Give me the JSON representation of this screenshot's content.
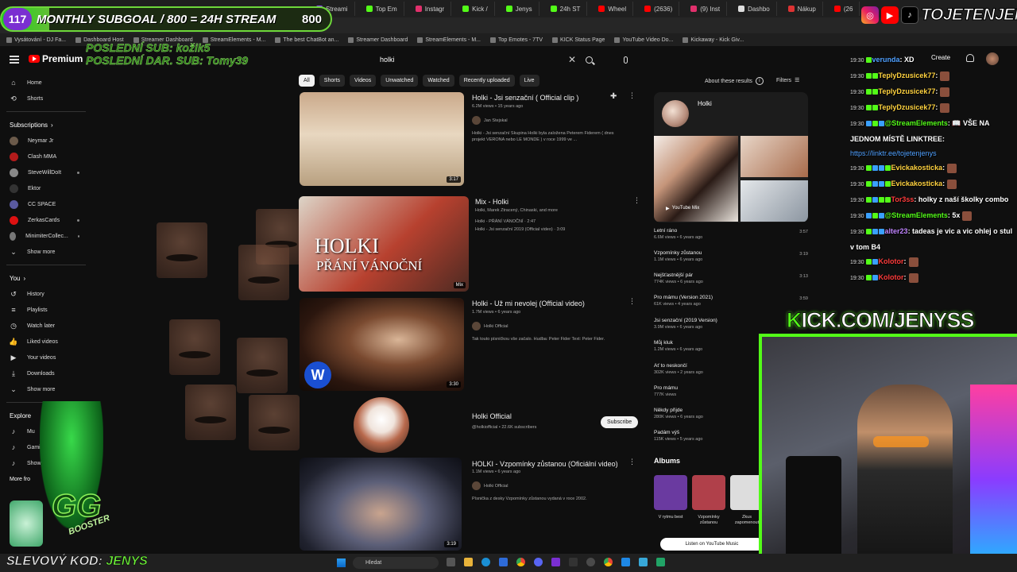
{
  "overlay": {
    "subgoal_count": "117",
    "subgoal_text": "MONTHLY SUBGOAL / 800 = 24H STREAM",
    "subgoal_target": "800",
    "subgoal_progress": 0.146,
    "last_sub_line1": "POSLEDNÍ SUB: kožik5",
    "last_sub_line2": "POSLEDNÍ DAR. SUB: Tomy39",
    "social_handle": "TOJETENJENYS",
    "kick_prefix": "K",
    "kick_rest": "ICK.COM/JENYSS",
    "coupon_label": "SLEVOVÝ KOD:",
    "coupon_code": "JENYS"
  },
  "browser": {
    "tabs": [
      "Streami",
      "Top Em",
      "Instagr",
      "Kick /",
      "Jenys",
      "24h ST",
      "Wheel",
      "(2636)",
      "(9) Inst",
      "Dashbo",
      "Nákup",
      "(26"
    ],
    "bookmarks": [
      "Vysátování - DJ Fa...",
      "Dashboard Host",
      "Streamer Dashboard",
      "StreamElements - M...",
      "The best ChatBot an...",
      "Streamer Dashboard",
      "StreamElements - M...",
      "Top Emotes - 7TV",
      "KICK Status Page",
      "YouTube Video Do...",
      "Kickaway - Kick Giv..."
    ]
  },
  "header": {
    "logo": "Premium",
    "search_value": "holki",
    "create_label": "Create"
  },
  "sidebar": {
    "main": [
      {
        "label": "Home",
        "icon": "home-icon"
      },
      {
        "label": "Shorts",
        "icon": "shorts-icon"
      }
    ],
    "subscriptions_title": "Subscriptions",
    "subscriptions": [
      {
        "label": "Neymar Jr",
        "color": "#6b5a4a"
      },
      {
        "label": "Clash MMA",
        "color": "#b31b1b"
      },
      {
        "label": "SteveWillDoIt",
        "color": "#888"
      },
      {
        "label": "Ektor",
        "color": "#333"
      },
      {
        "label": "CC SPACE",
        "color": "#5a5aa0"
      },
      {
        "label": "ZerkasCards",
        "color": "#d11"
      },
      {
        "label": "MinimiterCollec...",
        "color": "#777"
      }
    ],
    "show_more": "Show more",
    "you_title": "You",
    "you": [
      {
        "label": "History",
        "icon": "history-icon"
      },
      {
        "label": "Playlists",
        "icon": "playlists-icon"
      },
      {
        "label": "Watch later",
        "icon": "watch-later-icon"
      },
      {
        "label": "Liked videos",
        "icon": "liked-icon"
      },
      {
        "label": "Your videos",
        "icon": "your-videos-icon"
      },
      {
        "label": "Downloads",
        "icon": "downloads-icon"
      }
    ],
    "show_more_2": "Show more",
    "explore_title": "Explore",
    "explore": [
      "Mu",
      "Gami",
      "Show m"
    ],
    "more_from": "More fro"
  },
  "chips": [
    "All",
    "Shorts",
    "Videos",
    "Unwatched",
    "Watched",
    "Recently uploaded",
    "Live"
  ],
  "about_label": "About these results",
  "filters_label": "Filters",
  "results": [
    {
      "title": "Holki - Jsi senzační ( Official clip )",
      "meta": "6.2M views • 15 years ago",
      "channel": "Jan Stejskal",
      "desc1": "Holki - Jsi senzační Skupina Holki byla založena Peterem Fiderem ( dnes",
      "desc2": "projekt VERONA nebo LE MONDE ) v roce 1999 ve ...",
      "duration": "3:17"
    },
    {
      "title": "Mix - Holki",
      "meta": "Holki, Marek Ztracený, Chinaski, and more",
      "desc1": "Holki - PŘÁNÍ VÁNOČNÍ · 2:47",
      "desc2": "Holki - Jsi senzační 2019 (Official video) · 3:09",
      "duration": "Mix",
      "thumb_text1": "HOLKI",
      "thumb_text2": "PŘÁNÍ VÁNOČNÍ"
    },
    {
      "title": "Holki - Už mi nevolej (Official video)",
      "meta": "1.7M views • 6 years ago",
      "channel": "Holki Official",
      "desc1": "Tak touto písničkou vše začalo. Hudba: Peter Fider Text: Peter Fider.",
      "duration": "3:30"
    },
    {
      "title": "Holki Official",
      "handle": "@holkiofficial • 22.6K subscribers",
      "subscribe": "Subscribe"
    },
    {
      "title": "HOLKI - Vzpomínky zůstanou (Oficiální video)",
      "meta": "1.1M views • 6 years ago",
      "channel": "Holki Official",
      "desc1": "Písnička z desky Vzpomínky zůstanou vydaná v roce 2002.",
      "duration": "3:19"
    }
  ],
  "mix_panel": {
    "title": "Holki",
    "mix_label": "YouTube Mix",
    "tracks": [
      {
        "t": "Letní ráno",
        "m": "6.6M views • 6 years ago",
        "d": "3:57"
      },
      {
        "t": "Vzpomínky zůstanou",
        "m": "1.1M views • 6 years ago",
        "d": "3:19"
      },
      {
        "t": "Nejšťastnější pár",
        "m": "774K views • 6 years ago",
        "d": "3:13"
      },
      {
        "t": "Pro mámu (Version 2021)",
        "m": "61K views • 4 years ago",
        "d": "3:59"
      },
      {
        "t": "Jsi senzační (2019 Version)",
        "m": "3.9M views • 6 years ago",
        "d": ""
      },
      {
        "t": "Můj kluk",
        "m": "1.2M views • 6 years ago",
        "d": ""
      },
      {
        "t": "Ať to neskončí",
        "m": "302K views • 2 years ago",
        "d": ""
      },
      {
        "t": "Pro mámu",
        "m": "777K views",
        "d": ""
      },
      {
        "t": "Někdy přijde",
        "m": "280K views • 6 years ago",
        "d": ""
      },
      {
        "t": "Padám výš",
        "m": "115K views • 5 years ago",
        "d": ""
      }
    ],
    "albums_title": "Albums",
    "albums": [
      {
        "cap": "V rytmu best",
        "color": "#6a3aa0"
      },
      {
        "cap": "Vzpomínky zůstanou",
        "color": "#b0404a"
      },
      {
        "cap": "Zkus zapomenout",
        "color": "#ddd"
      }
    ],
    "listen_label": "Listen on YouTube Music"
  },
  "chat": [
    {
      "time": "19:30",
      "user": "verunda",
      "ucol": "#4fa0ff",
      "text": ": XD",
      "badges": [
        "#53fc18"
      ]
    },
    {
      "time": "19:30",
      "user": "TeplyDzusicek77",
      "ucol": "#ffd23f",
      "text": ":",
      "badges": [
        "#53fc18",
        "#53fc18"
      ],
      "emo": true
    },
    {
      "time": "19:30",
      "user": "TeplyDzusicek77",
      "ucol": "#ffd23f",
      "text": ":",
      "badges": [
        "#53fc18",
        "#53fc18"
      ],
      "emo": true
    },
    {
      "time": "19:30",
      "user": "TeplyDzusicek77",
      "ucol": "#ffd23f",
      "text": ":",
      "badges": [
        "#53fc18",
        "#53fc18"
      ],
      "emo": true
    },
    {
      "time": "19:30",
      "user": "@StreamElements",
      "ucol": "#53fc18",
      "text": ": 📖 VŠE NA JEDNOM MÍSTĚ LINKTREE:",
      "badges": [
        "#3aa0ff",
        "#53fc18",
        "#3aa0ff"
      ]
    },
    {
      "link": "https://linktr.ee/tojetenjenys"
    },
    {
      "time": "19:30",
      "user": "Evickakosticka",
      "ucol": "#ffd23f",
      "text": ":",
      "badges": [
        "#53fc18",
        "#3aa0ff",
        "#3aa0ff",
        "#53fc18"
      ],
      "emo": true
    },
    {
      "time": "19:30",
      "user": "Evickakosticka",
      "ucol": "#ffd23f",
      "text": ":",
      "badges": [
        "#53fc18",
        "#3aa0ff",
        "#3aa0ff",
        "#53fc18"
      ],
      "emo": true
    },
    {
      "time": "19:30",
      "user": "Tor3ss",
      "ucol": "#ff3b3b",
      "text": ": holky z naší školky combo",
      "badges": [
        "#53fc18",
        "#3aa0ff",
        "#53fc18",
        "#53fc18"
      ]
    },
    {
      "time": "19:30",
      "user": "@StreamElements",
      "ucol": "#53fc18",
      "text": ": 5x",
      "badges": [
        "#3aa0ff",
        "#53fc18",
        "#3aa0ff"
      ],
      "emo": true
    },
    {
      "time": "19:30",
      "user": "alter23",
      "ucol": "#c084ff",
      "text": ": tadeas je vic a vic ohlej o stul v tom B4",
      "badges": [
        "#53fc18",
        "#3aa0ff",
        "#3aa0ff"
      ]
    },
    {
      "time": "19:30",
      "user": "Kolotor",
      "ucol": "#ff3b3b",
      "text": ":",
      "badges": [
        "#53fc18",
        "#3aa0ff"
      ],
      "emo": true
    },
    {
      "time": "19:30",
      "user": "Kolotor",
      "ucol": "#ff3b3b",
      "text": ":",
      "badges": [
        "#53fc18",
        "#3aa0ff"
      ],
      "emo": true
    }
  ],
  "taskbar": {
    "search_label": "Hledat"
  }
}
